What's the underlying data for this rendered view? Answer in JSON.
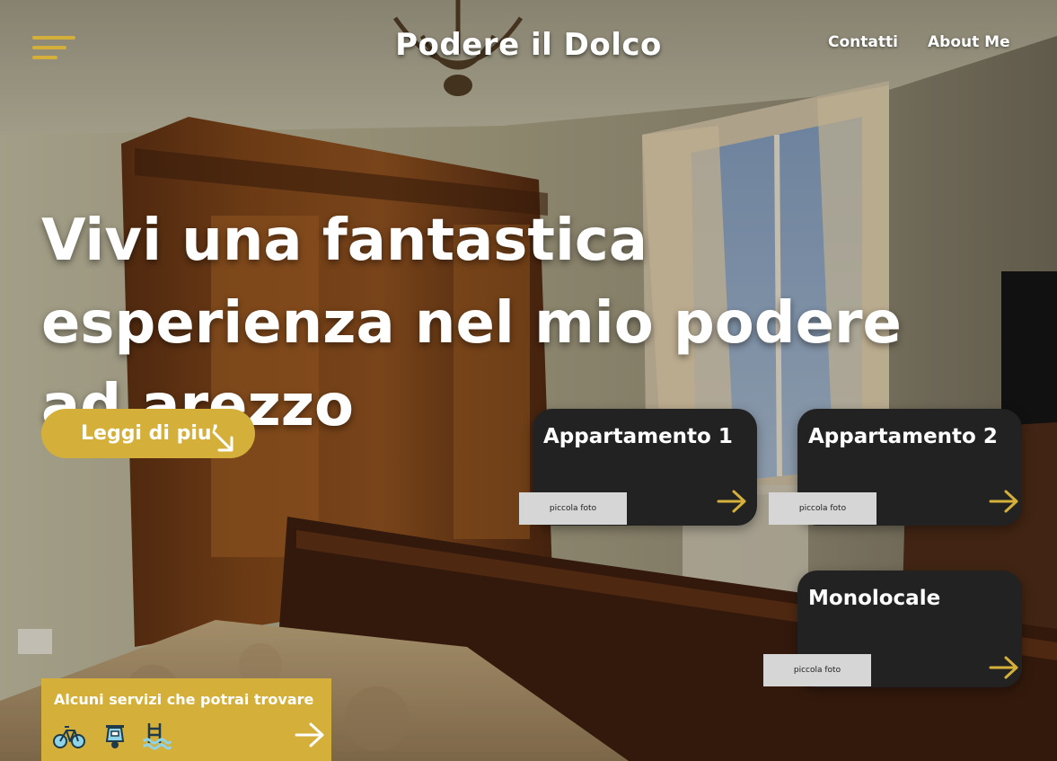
{
  "header": {
    "site_title": "Podere il Dolco",
    "nav": [
      {
        "label": "Contatti"
      },
      {
        "label": "About Me"
      }
    ]
  },
  "hero": {
    "title": "Vivi una fantastica esperienza nel mio podere ad arezzo",
    "cta_label": "Leggi di piu’"
  },
  "cards": [
    {
      "title": "Appartamento 1",
      "photo_label": "piccola foto"
    },
    {
      "title": "Appartamento 2",
      "photo_label": "piccola foto"
    },
    {
      "title": "Monolocale",
      "photo_label": "piccola foto"
    }
  ],
  "services": {
    "title": "Alcuni servizi che potrai trovare",
    "icons": [
      "bicycle-icon",
      "scooter-icon",
      "pool-ladder-icon"
    ]
  },
  "colors": {
    "accent": "#d4b03a",
    "card_bg": "#222222",
    "photo_placeholder": "#d6d6d6",
    "text": "#ffffff"
  }
}
